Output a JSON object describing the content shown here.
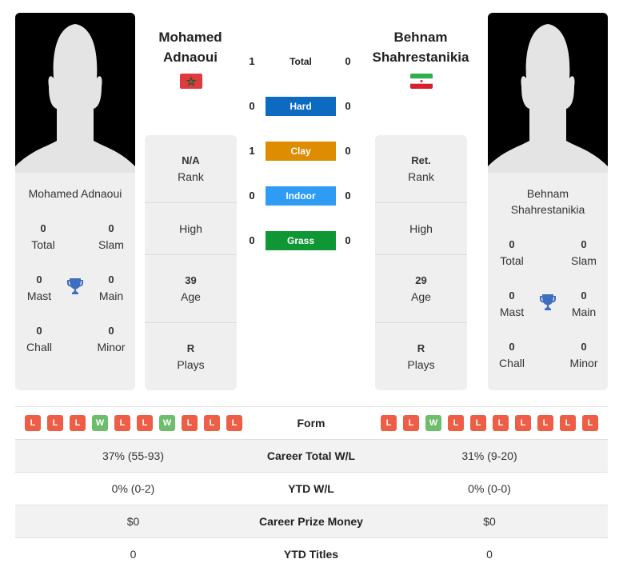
{
  "colors": {
    "hard": "#0c6bc0",
    "clay": "#de8c00",
    "indoor": "#2e9cf5",
    "grass": "#0f9735",
    "loss": "#ee5e46",
    "win": "#6dbd6d",
    "trophy": "#3d6fbf"
  },
  "player1": {
    "name_line1": "Mohamed",
    "name_line2": "Adnaoui",
    "card_name": "Mohamed Adnaoui",
    "flag": "morocco-flag",
    "titles": {
      "total": {
        "value": "0",
        "label": "Total"
      },
      "slam": {
        "value": "0",
        "label": "Slam"
      },
      "mast": {
        "value": "0",
        "label": "Mast"
      },
      "main": {
        "value": "0",
        "label": "Main"
      },
      "chall": {
        "value": "0",
        "label": "Chall"
      },
      "minor": {
        "value": "0",
        "label": "Minor"
      }
    },
    "info": {
      "rank": {
        "value": "N/A",
        "label": "Rank"
      },
      "high": {
        "label": "High"
      },
      "age": {
        "value": "39",
        "label": "Age"
      },
      "plays": {
        "value": "R",
        "label": "Plays"
      }
    },
    "form": [
      "L",
      "L",
      "L",
      "W",
      "L",
      "L",
      "W",
      "L",
      "L",
      "L"
    ]
  },
  "player2": {
    "name_line1": "Behnam",
    "name_line2": "Shahrestanikia",
    "card_name_line1": "Behnam",
    "card_name_line2": "Shahrestanikia",
    "flag": "iran-flag",
    "titles": {
      "total": {
        "value": "0",
        "label": "Total"
      },
      "slam": {
        "value": "0",
        "label": "Slam"
      },
      "mast": {
        "value": "0",
        "label": "Mast"
      },
      "main": {
        "value": "0",
        "label": "Main"
      },
      "chall": {
        "value": "0",
        "label": "Chall"
      },
      "minor": {
        "value": "0",
        "label": "Minor"
      }
    },
    "info": {
      "rank": {
        "value": "Ret.",
        "label": "Rank"
      },
      "high": {
        "label": "High"
      },
      "age": {
        "value": "29",
        "label": "Age"
      },
      "plays": {
        "value": "R",
        "label": "Plays"
      }
    },
    "form": [
      "L",
      "L",
      "W",
      "L",
      "L",
      "L",
      "L",
      "L",
      "L",
      "L"
    ]
  },
  "h2h": [
    {
      "label": "Total",
      "p1": "1",
      "p2": "0",
      "surface": "total"
    },
    {
      "label": "Hard",
      "p1": "0",
      "p2": "0",
      "surface": "hard"
    },
    {
      "label": "Clay",
      "p1": "1",
      "p2": "0",
      "surface": "clay"
    },
    {
      "label": "Indoor",
      "p1": "0",
      "p2": "0",
      "surface": "indoor"
    },
    {
      "label": "Grass",
      "p1": "0",
      "p2": "0",
      "surface": "grass"
    }
  ],
  "stats": {
    "form_label": "Form",
    "rows": [
      {
        "label": "Career Total W/L",
        "p1": "37% (55-93)",
        "p2": "31% (9-20)"
      },
      {
        "label": "YTD W/L",
        "p1": "0% (0-2)",
        "p2": "0% (0-0)"
      },
      {
        "label": "Career Prize Money",
        "p1": "$0",
        "p2": "$0"
      },
      {
        "label": "YTD Titles",
        "p1": "0",
        "p2": "0"
      }
    ]
  }
}
